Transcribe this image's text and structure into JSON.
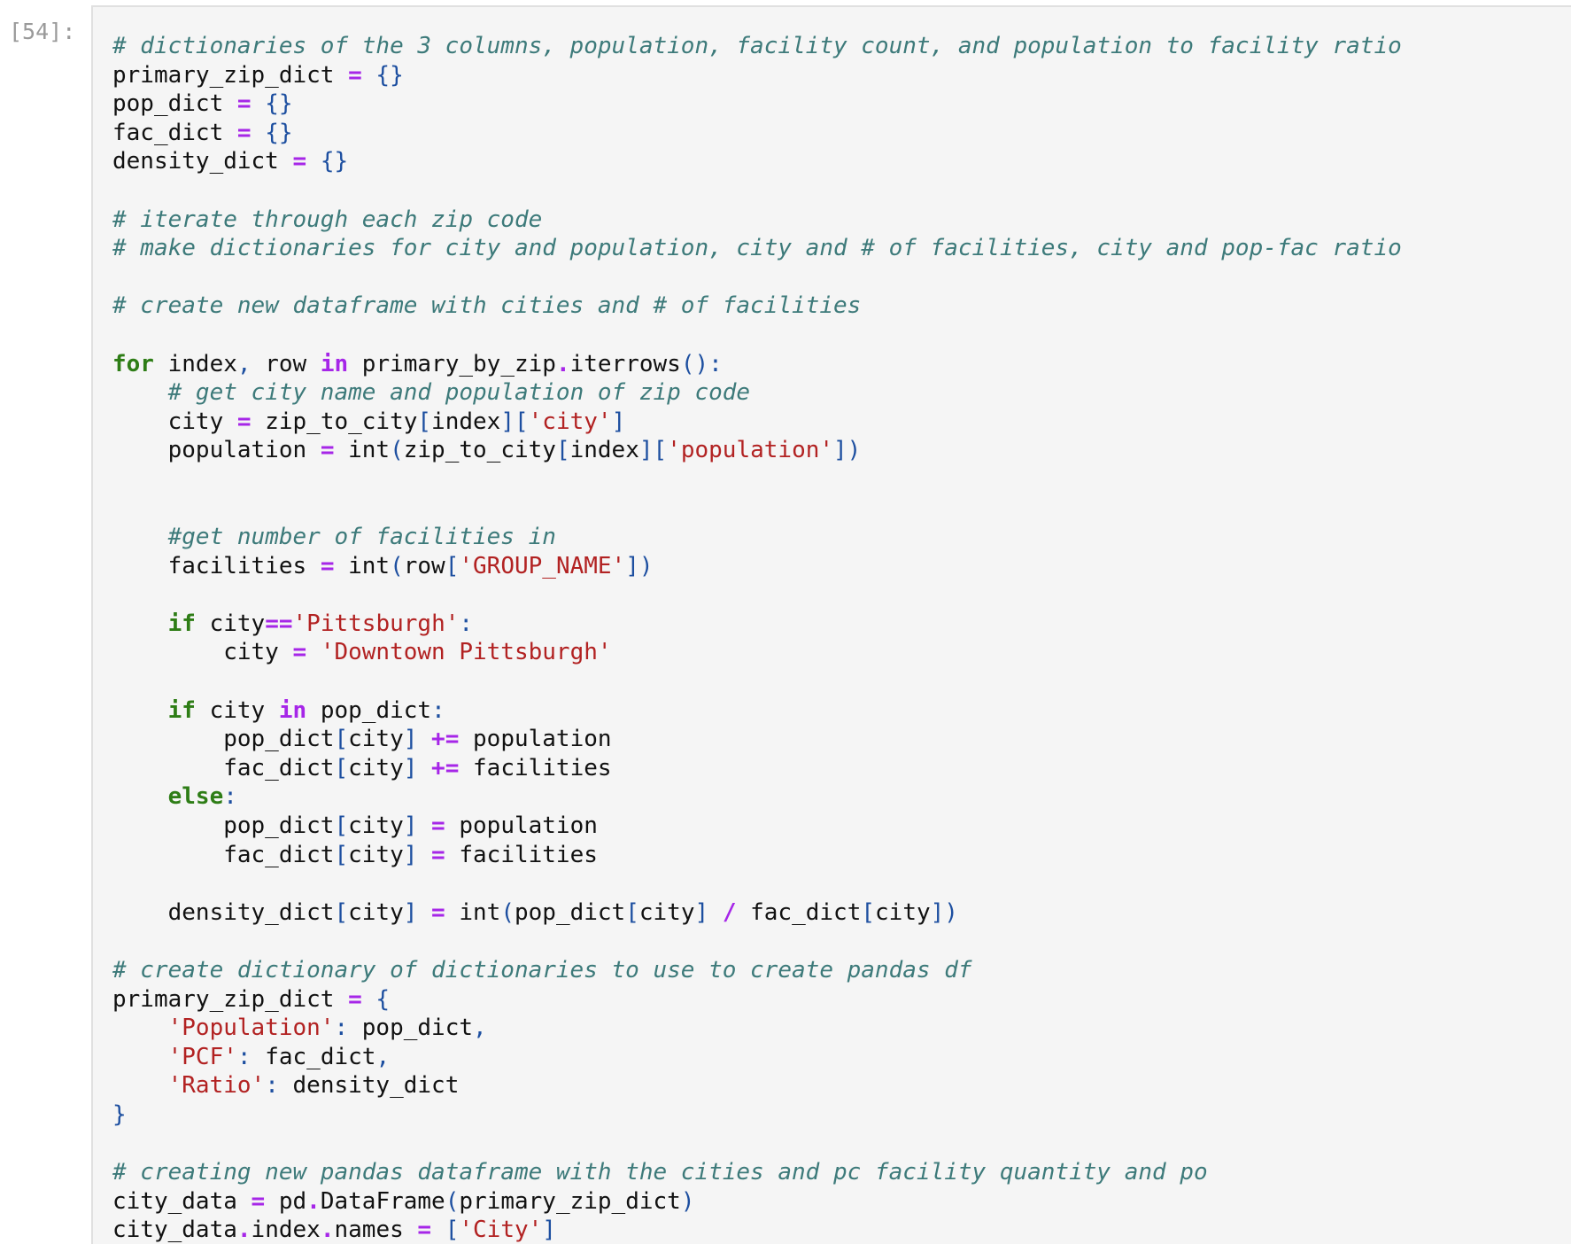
{
  "cell": {
    "prompt": "[54]:",
    "code_lines": [
      [
        [
          "c",
          "# dictionaries of the 3 columns, population, facility count, and population to facility ratio"
        ]
      ],
      [
        [
          "t",
          "primary_zip_dict "
        ],
        [
          "o",
          "="
        ],
        [
          "t",
          " "
        ],
        [
          "p",
          "{}"
        ]
      ],
      [
        [
          "t",
          "pop_dict "
        ],
        [
          "o",
          "="
        ],
        [
          "t",
          " "
        ],
        [
          "p",
          "{}"
        ]
      ],
      [
        [
          "t",
          "fac_dict "
        ],
        [
          "o",
          "="
        ],
        [
          "t",
          " "
        ],
        [
          "p",
          "{}"
        ]
      ],
      [
        [
          "t",
          "density_dict "
        ],
        [
          "o",
          "="
        ],
        [
          "t",
          " "
        ],
        [
          "p",
          "{}"
        ]
      ],
      [],
      [
        [
          "c",
          "# iterate through each zip code"
        ]
      ],
      [
        [
          "c",
          "# make dictionaries for city and population, city and # of facilities, city and pop-fac ratio"
        ]
      ],
      [],
      [
        [
          "c",
          "# create new dataframe with cities and # of facilities"
        ]
      ],
      [],
      [
        [
          "k",
          "for"
        ],
        [
          "t",
          " index"
        ],
        [
          "p",
          ","
        ],
        [
          "t",
          " row "
        ],
        [
          "o",
          "in"
        ],
        [
          "t",
          " primary_by_zip"
        ],
        [
          "o",
          "."
        ],
        [
          "t",
          "iterrows"
        ],
        [
          "p",
          "():"
        ]
      ],
      [
        [
          "t",
          "    "
        ],
        [
          "c",
          "# get city name and population of zip code"
        ]
      ],
      [
        [
          "t",
          "    city "
        ],
        [
          "o",
          "="
        ],
        [
          "t",
          " zip_to_city"
        ],
        [
          "p",
          "["
        ],
        [
          "t",
          "index"
        ],
        [
          "p",
          "]["
        ],
        [
          "s",
          "'city'"
        ],
        [
          "p",
          "]"
        ]
      ],
      [
        [
          "t",
          "    population "
        ],
        [
          "o",
          "="
        ],
        [
          "t",
          " int"
        ],
        [
          "p",
          "("
        ],
        [
          "t",
          "zip_to_city"
        ],
        [
          "p",
          "["
        ],
        [
          "t",
          "index"
        ],
        [
          "p",
          "]["
        ],
        [
          "s",
          "'population'"
        ],
        [
          "p",
          "])"
        ]
      ],
      [],
      [],
      [
        [
          "t",
          "    "
        ],
        [
          "c",
          "#get number of facilities in"
        ]
      ],
      [
        [
          "t",
          "    facilities "
        ],
        [
          "o",
          "="
        ],
        [
          "t",
          " int"
        ],
        [
          "p",
          "("
        ],
        [
          "t",
          "row"
        ],
        [
          "p",
          "["
        ],
        [
          "s",
          "'GROUP_NAME'"
        ],
        [
          "p",
          "])"
        ]
      ],
      [],
      [
        [
          "t",
          "    "
        ],
        [
          "k",
          "if"
        ],
        [
          "t",
          " city"
        ],
        [
          "o",
          "=="
        ],
        [
          "s",
          "'Pittsburgh'"
        ],
        [
          "p",
          ":"
        ]
      ],
      [
        [
          "t",
          "        city "
        ],
        [
          "o",
          "="
        ],
        [
          "t",
          " "
        ],
        [
          "s",
          "'Downtown Pittsburgh'"
        ]
      ],
      [],
      [
        [
          "t",
          "    "
        ],
        [
          "k",
          "if"
        ],
        [
          "t",
          " city "
        ],
        [
          "o",
          "in"
        ],
        [
          "t",
          " pop_dict"
        ],
        [
          "p",
          ":"
        ]
      ],
      [
        [
          "t",
          "        pop_dict"
        ],
        [
          "p",
          "["
        ],
        [
          "t",
          "city"
        ],
        [
          "p",
          "]"
        ],
        [
          "t",
          " "
        ],
        [
          "o",
          "+="
        ],
        [
          "t",
          " population"
        ]
      ],
      [
        [
          "t",
          "        fac_dict"
        ],
        [
          "p",
          "["
        ],
        [
          "t",
          "city"
        ],
        [
          "p",
          "]"
        ],
        [
          "t",
          " "
        ],
        [
          "o",
          "+="
        ],
        [
          "t",
          " facilities"
        ]
      ],
      [
        [
          "t",
          "    "
        ],
        [
          "k",
          "else"
        ],
        [
          "p",
          ":"
        ]
      ],
      [
        [
          "t",
          "        pop_dict"
        ],
        [
          "p",
          "["
        ],
        [
          "t",
          "city"
        ],
        [
          "p",
          "]"
        ],
        [
          "t",
          " "
        ],
        [
          "o",
          "="
        ],
        [
          "t",
          " population"
        ]
      ],
      [
        [
          "t",
          "        fac_dict"
        ],
        [
          "p",
          "["
        ],
        [
          "t",
          "city"
        ],
        [
          "p",
          "]"
        ],
        [
          "t",
          " "
        ],
        [
          "o",
          "="
        ],
        [
          "t",
          " facilities"
        ]
      ],
      [],
      [
        [
          "t",
          "    density_dict"
        ],
        [
          "p",
          "["
        ],
        [
          "t",
          "city"
        ],
        [
          "p",
          "]"
        ],
        [
          "t",
          " "
        ],
        [
          "o",
          "="
        ],
        [
          "t",
          " int"
        ],
        [
          "p",
          "("
        ],
        [
          "t",
          "pop_dict"
        ],
        [
          "p",
          "["
        ],
        [
          "t",
          "city"
        ],
        [
          "p",
          "]"
        ],
        [
          "t",
          " "
        ],
        [
          "o",
          "/"
        ],
        [
          "t",
          " fac_dict"
        ],
        [
          "p",
          "["
        ],
        [
          "t",
          "city"
        ],
        [
          "p",
          "])"
        ]
      ],
      [],
      [
        [
          "c",
          "# create dictionary of dictionaries to use to create pandas df"
        ]
      ],
      [
        [
          "t",
          "primary_zip_dict "
        ],
        [
          "o",
          "="
        ],
        [
          "t",
          " "
        ],
        [
          "p",
          "{"
        ]
      ],
      [
        [
          "t",
          "    "
        ],
        [
          "s",
          "'Population'"
        ],
        [
          "p",
          ":"
        ],
        [
          "t",
          " pop_dict"
        ],
        [
          "p",
          ","
        ]
      ],
      [
        [
          "t",
          "    "
        ],
        [
          "s",
          "'PCF'"
        ],
        [
          "p",
          ":"
        ],
        [
          "t",
          " fac_dict"
        ],
        [
          "p",
          ","
        ]
      ],
      [
        [
          "t",
          "    "
        ],
        [
          "s",
          "'Ratio'"
        ],
        [
          "p",
          ":"
        ],
        [
          "t",
          " density_dict"
        ]
      ],
      [
        [
          "p",
          "}"
        ]
      ],
      [],
      [
        [
          "c",
          "# creating new pandas dataframe with the cities and pc facility quantity and po"
        ]
      ],
      [
        [
          "t",
          "city_data "
        ],
        [
          "o",
          "="
        ],
        [
          "t",
          " pd"
        ],
        [
          "o",
          "."
        ],
        [
          "t",
          "DataFrame"
        ],
        [
          "p",
          "("
        ],
        [
          "t",
          "primary_zip_dict"
        ],
        [
          "p",
          ")"
        ]
      ],
      [
        [
          "t",
          "city_data"
        ],
        [
          "o",
          "."
        ],
        [
          "t",
          "index"
        ],
        [
          "o",
          "."
        ],
        [
          "t",
          "names "
        ],
        [
          "o",
          "="
        ],
        [
          "t",
          " "
        ],
        [
          "p",
          "["
        ],
        [
          "s",
          "'City'"
        ],
        [
          "p",
          "]"
        ]
      ]
    ]
  }
}
